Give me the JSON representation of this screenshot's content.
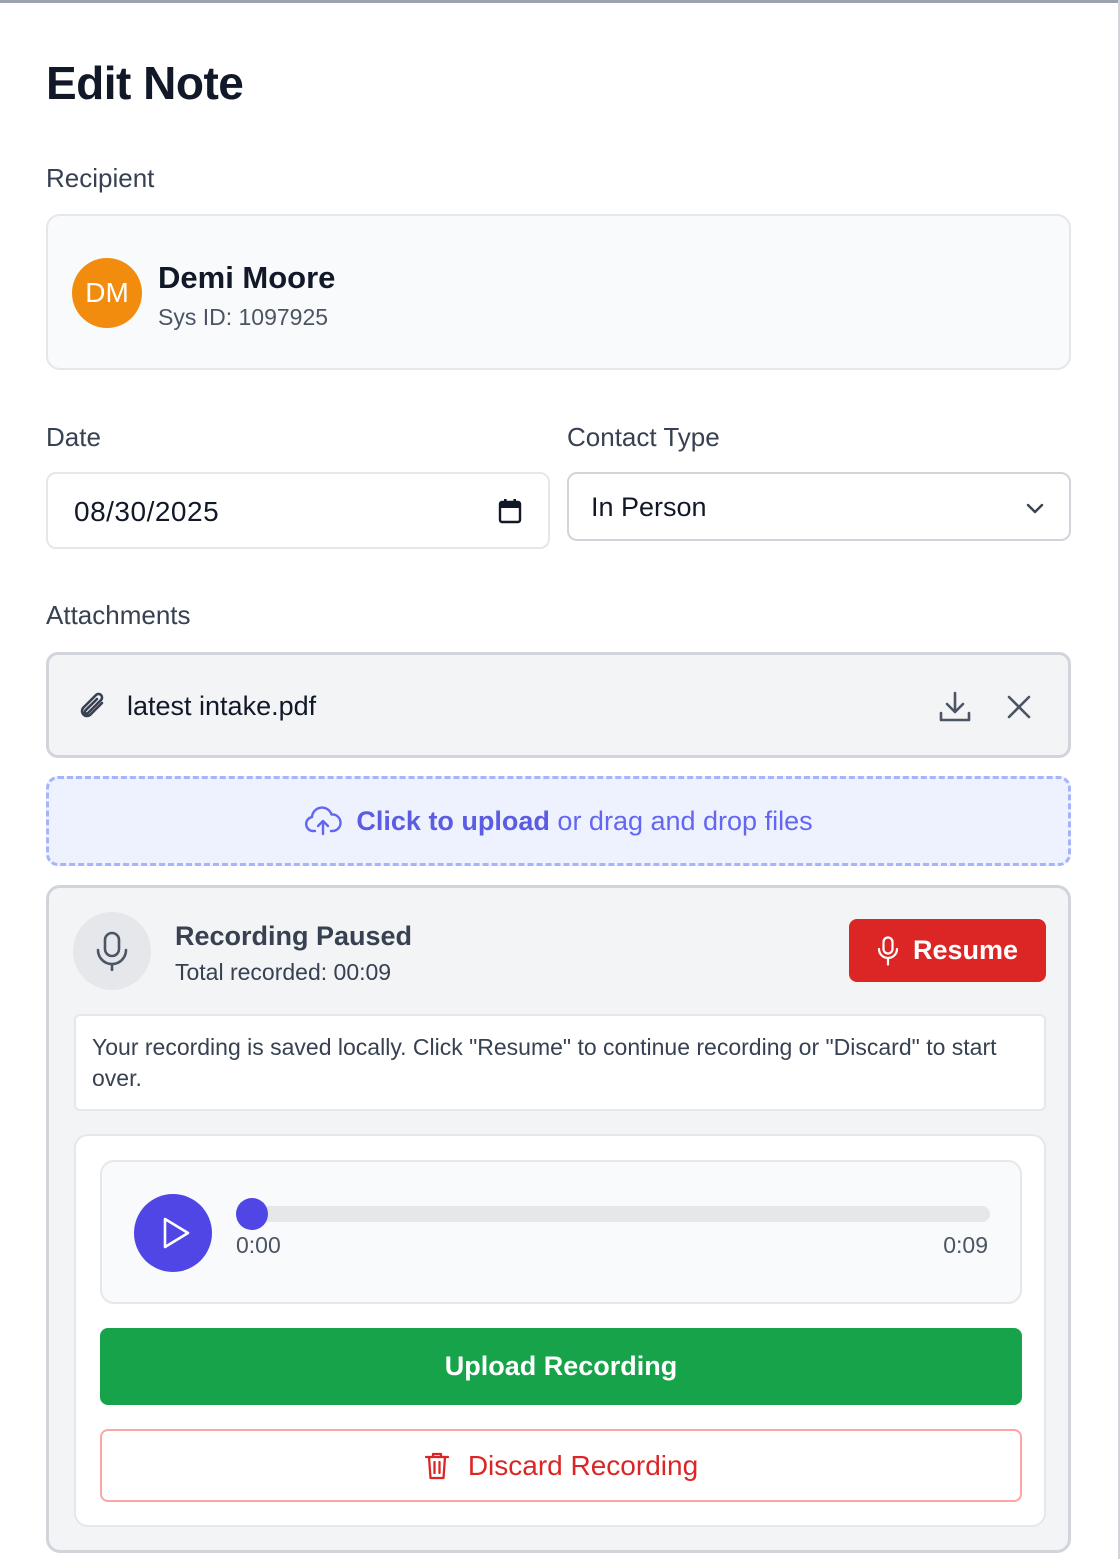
{
  "page": {
    "title": "Edit Note"
  },
  "recipient": {
    "label": "Recipient",
    "initials": "DM",
    "name": "Demi Moore",
    "sys_id": "Sys ID: 1097925",
    "avatar_color": "#f28c0f"
  },
  "date": {
    "label": "Date",
    "value": "08/30/2025",
    "icon": "calendar-icon"
  },
  "contact_type": {
    "label": "Contact Type",
    "value": "In Person",
    "icon": "chevron-down-icon"
  },
  "attachments": {
    "label": "Attachments",
    "files": [
      {
        "name": "latest intake.pdf"
      }
    ],
    "dropzone": {
      "strong": "Click to upload",
      "rest": " or drag and drop files",
      "icon": "cloud-upload-icon"
    }
  },
  "recording": {
    "status_title": "Recording Paused",
    "total": "Total recorded: 00:09",
    "resume_label": "Resume",
    "info": "Your recording is saved locally. Click \"Resume\" to continue recording or \"Discard\" to start over.",
    "player": {
      "current": "0:00",
      "duration": "0:09",
      "progress": 0.0
    },
    "upload_label": "Upload Recording",
    "discard_label": "Discard Recording"
  },
  "colors": {
    "accent": "#4f46e5",
    "danger": "#dc2626",
    "success": "#16a34a"
  }
}
